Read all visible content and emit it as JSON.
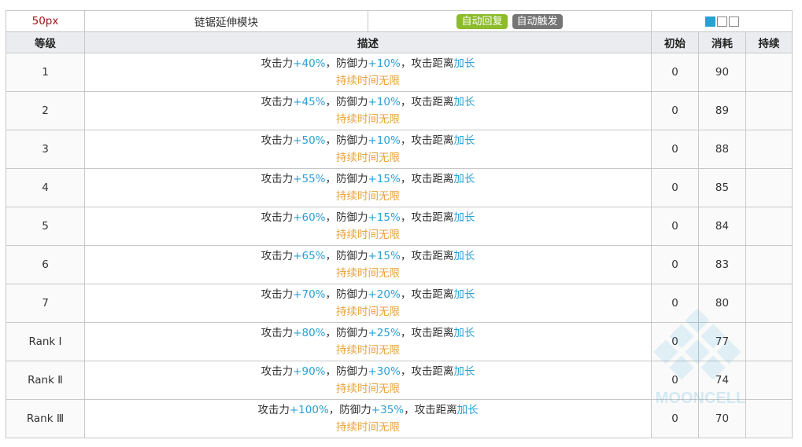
{
  "header": {
    "range": "50px",
    "name": "链锯延伸模块",
    "tags": [
      "自动回复",
      "自动触发"
    ],
    "level_squares": [
      true,
      false,
      false
    ]
  },
  "columns": {
    "level": "等级",
    "description": "描述",
    "initial": "初始",
    "cost": "消耗",
    "duration": "持续"
  },
  "text": {
    "atk": "攻击力",
    "def": "，防御力",
    "range": "，攻击距离",
    "range_up": "加长",
    "duration": "持续时间无限"
  },
  "rows": [
    {
      "level": "1",
      "atk": "+40%",
      "def": "+10%",
      "initial": "0",
      "cost": "90",
      "duration": ""
    },
    {
      "level": "2",
      "atk": "+45%",
      "def": "+10%",
      "initial": "0",
      "cost": "89",
      "duration": ""
    },
    {
      "level": "3",
      "atk": "+50%",
      "def": "+10%",
      "initial": "0",
      "cost": "88",
      "duration": ""
    },
    {
      "level": "4",
      "atk": "+55%",
      "def": "+15%",
      "initial": "0",
      "cost": "85",
      "duration": ""
    },
    {
      "level": "5",
      "atk": "+60%",
      "def": "+15%",
      "initial": "0",
      "cost": "84",
      "duration": ""
    },
    {
      "level": "6",
      "atk": "+65%",
      "def": "+15%",
      "initial": "0",
      "cost": "83",
      "duration": ""
    },
    {
      "level": "7",
      "atk": "+70%",
      "def": "+20%",
      "initial": "0",
      "cost": "80",
      "duration": ""
    },
    {
      "level": "Rank Ⅰ",
      "atk": "+80%",
      "def": "+25%",
      "initial": "0",
      "cost": "77",
      "duration": ""
    },
    {
      "level": "Rank Ⅱ",
      "atk": "+90%",
      "def": "+30%",
      "initial": "0",
      "cost": "74",
      "duration": ""
    },
    {
      "level": "Rank Ⅲ",
      "atk": "+100%",
      "def": "+35%",
      "initial": "0",
      "cost": "70",
      "duration": ""
    }
  ],
  "watermark": "MOONCELL",
  "colors": {
    "value_blue": "#2a9fd6",
    "duration_orange": "#e8a33b",
    "range_red": "#a01616",
    "tag_green": "#8cbb2b",
    "tag_gray": "#757575"
  }
}
